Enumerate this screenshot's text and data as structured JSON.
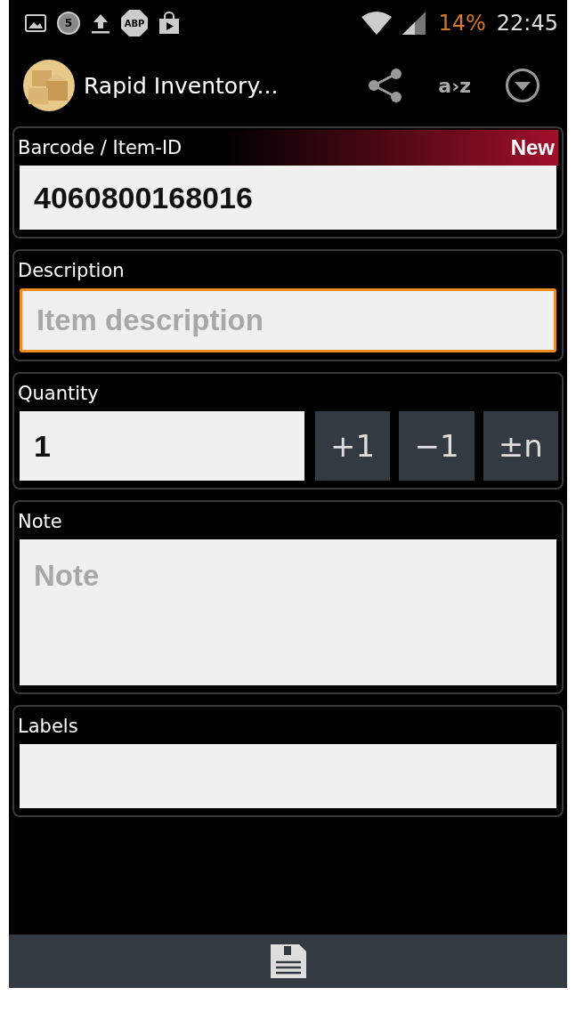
{
  "status_bar": {
    "mail_count": "5",
    "adblock_label": "ABP",
    "battery": "14%",
    "time": "22:45"
  },
  "action_bar": {
    "title": "Rapid Inventory...",
    "sort_label": "a›z"
  },
  "fields": [
    {
      "kind": "barcode",
      "label": "Barcode / Item-ID",
      "badge": "New",
      "value": "4060800168016",
      "focused": false
    },
    {
      "kind": "text",
      "label": "Description",
      "placeholder": "Item description",
      "focused": true
    },
    {
      "kind": "quantity",
      "label": "Quantity",
      "value": "1",
      "focused": false,
      "buttons": [
        "+1",
        "−1",
        "±n"
      ]
    },
    {
      "kind": "multiline",
      "label": "Note",
      "placeholder": "Note",
      "focused": false
    },
    {
      "kind": "text",
      "label": "Labels",
      "focused": false
    }
  ]
}
